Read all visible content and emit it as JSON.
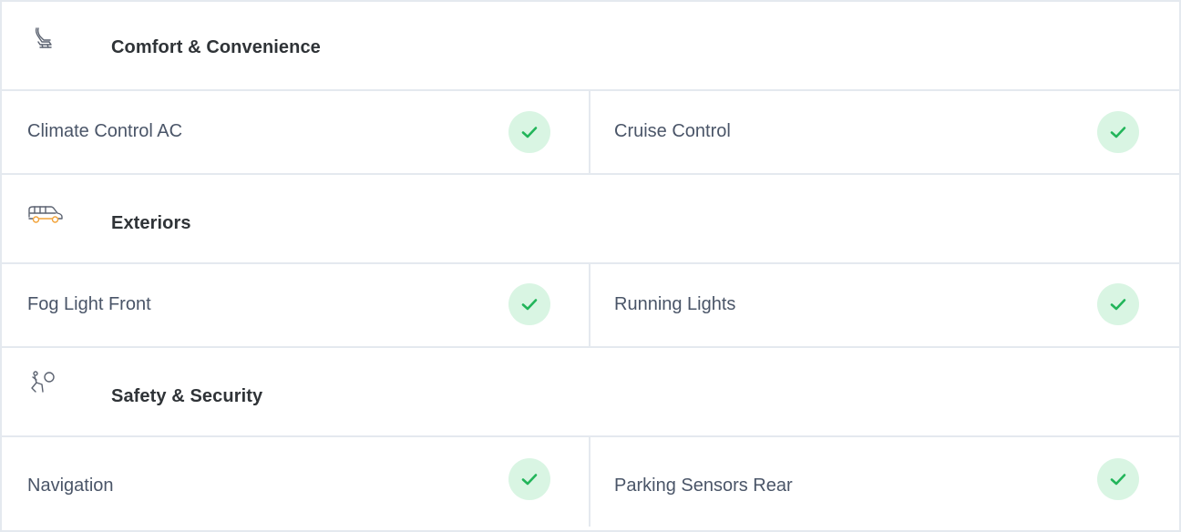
{
  "sections": [
    {
      "title": "Comfort & Convenience",
      "icon": "seat-icon",
      "items": [
        {
          "label": "Climate Control AC",
          "checked": true
        },
        {
          "label": "Cruise Control",
          "checked": true
        }
      ]
    },
    {
      "title": "Exteriors",
      "icon": "car-exterior-icon",
      "items": [
        {
          "label": "Fog Light Front",
          "checked": true
        },
        {
          "label": "Running Lights",
          "checked": true
        }
      ]
    },
    {
      "title": "Safety & Security",
      "icon": "airbag-icon",
      "items": [
        {
          "label": "Navigation",
          "checked": true
        },
        {
          "label": "Parking Sensors Rear",
          "checked": true
        }
      ]
    }
  ],
  "colors": {
    "check_bg": "#d9f5e3",
    "check_mark": "#22b55a",
    "icon_accent": "#f2a33a",
    "border": "#e4e9ef"
  }
}
